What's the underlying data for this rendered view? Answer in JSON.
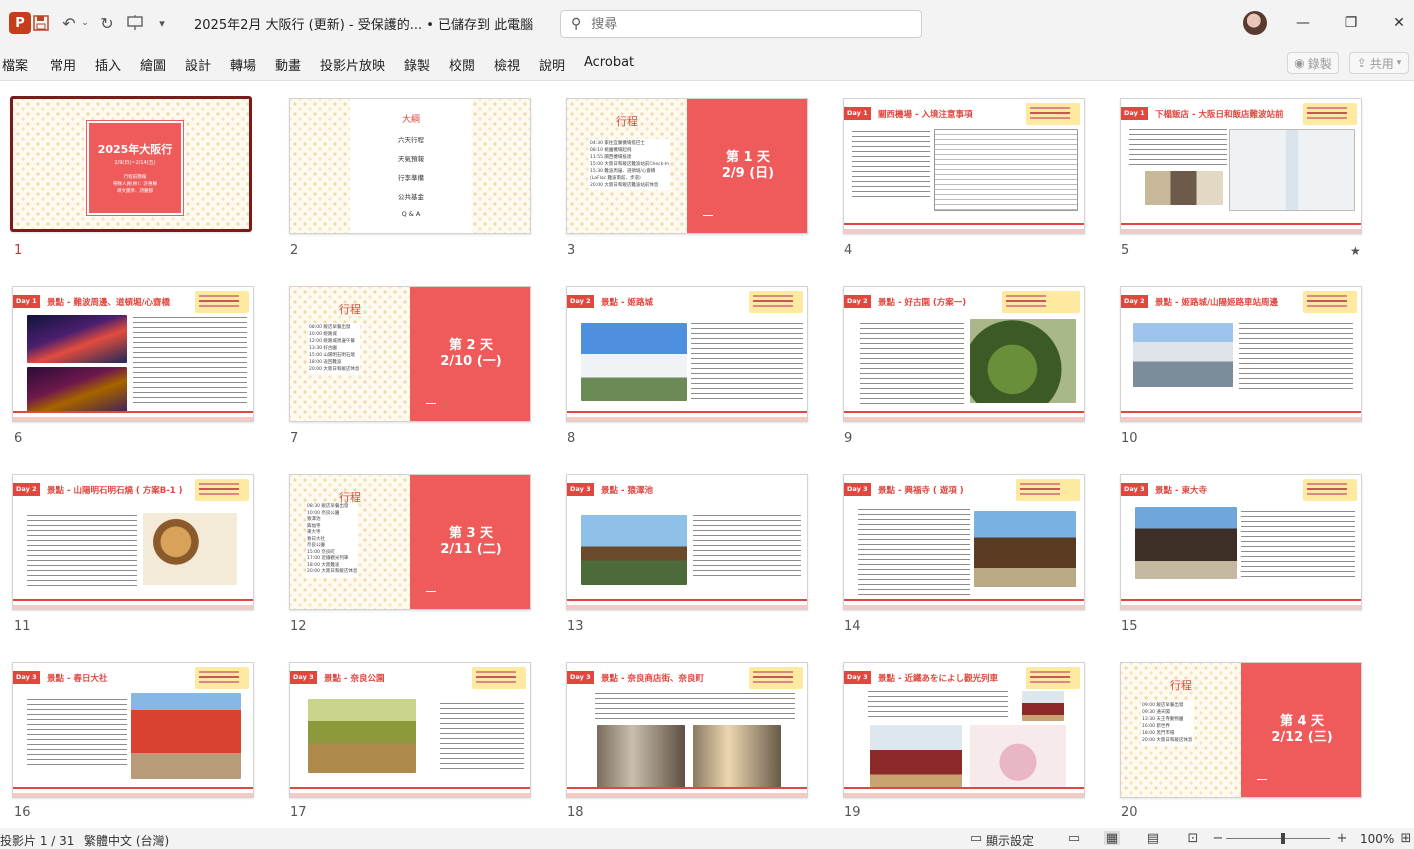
{
  "titlebar": {
    "app_icon": "P",
    "doc_title": "2025年2月 大阪行 (更新)  -  受保護的...  •  已儲存到 此電腦",
    "search_placeholder": "搜尋"
  },
  "menu": [
    "檔案",
    "常用",
    "插入",
    "繪圖",
    "設計",
    "轉場",
    "動畫",
    "投影片放映",
    "錄製",
    "校閱",
    "檢視",
    "說明",
    "Acrobat"
  ],
  "record_label": "錄製",
  "share_label": "共用",
  "cover": {
    "title": "2025年大阪行",
    "date": "2/9(日)~2/14(五)",
    "sub1": "行程前簡報",
    "sub2": "帶隊人員(林)：許惠棟",
    "sub3": "頌文團參、詩麗都"
  },
  "agenda": {
    "title": "大綱",
    "items": [
      "六天行程",
      "天氣預報",
      "行李準備",
      "公共基金",
      "Q & A"
    ]
  },
  "itineraries": [
    {
      "title": "行程",
      "day": "第 1 天",
      "date": "2/9 (日)",
      "lines": [
        "04:30 家往宜蘭機場搭巴士",
        "08:10 桃園機場起飛",
        "11:55 關西機場抵達",
        "15:00 大阪日和飯店難波站前Check-In",
        "15:30 難波周邊、道頓堀/心齋橋",
        "(LaFlac 難波南館、步道)",
        "20:00 大阪日和飯店難波站前休息"
      ]
    },
    {
      "title": "行程",
      "day": "第 2 天",
      "date": "2/10 (一)",
      "lines": [
        "08:00 飯店早餐出發",
        "10:00 姬路城",
        "12:00 姬路城周邊午餐",
        "13:30 好古園",
        "15:00 山陽明石明石燒",
        "18:00 返回難波",
        "20:00 大阪日和飯店休息"
      ]
    },
    {
      "title": "行程",
      "day": "第 3 天",
      "date": "2/11 (二)",
      "lines": [
        "08:30 飯店早餐出發",
        "10:00 奈良公園",
        "猿澤池",
        "興福寺",
        "東大寺",
        "春日大社",
        "奈良公園",
        "15:00 奈良町",
        "17:00 近鐵觀光列車",
        "18:00 大阪難波",
        "20:00 大阪日和飯店休息"
      ]
    },
    {
      "title": "行程",
      "day": "第 4 天",
      "date": "2/12 (三)",
      "lines": [
        "09:00 飯店早餐出發",
        "09:30 通天閣",
        "13:30 天王寺動物園",
        "16:00 新世界",
        "18:00 黑門市場",
        "20:00 大阪日和飯店休息"
      ]
    }
  ],
  "day_slides": [
    {
      "n": "4",
      "day": "Day 1",
      "title": "關西機場 - 入境注意事項"
    },
    {
      "n": "5",
      "day": "Day 1",
      "title": "下榻飯店 - 大阪日和飯店難波站前"
    },
    {
      "n": "6",
      "day": "Day 1",
      "title": "景點 - 難波周邊、道頓堀/心齋橋"
    },
    {
      "n": "8",
      "day": "Day 2",
      "title": "景點 - 姬路城"
    },
    {
      "n": "9",
      "day": "Day 2",
      "title": "景點 - 好古園 (方案一)"
    },
    {
      "n": "10",
      "day": "Day 2",
      "title": "景點 - 姬路城/山陽姬路車站周邊"
    },
    {
      "n": "11",
      "day": "Day 2",
      "title": "景點 - 山陽明石明石燒 ( 方案B-1 )"
    },
    {
      "n": "13",
      "day": "Day 3",
      "title": "景點 - 猿澤池"
    },
    {
      "n": "14",
      "day": "Day 3",
      "title": "景點 - 興福寺 ( 遊項 )"
    },
    {
      "n": "15",
      "day": "Day 3",
      "title": "景點 - 東大寺"
    },
    {
      "n": "16",
      "day": "Day 3",
      "title": "景點 - 春日大社"
    },
    {
      "n": "17",
      "day": "Day 3",
      "title": "景點 - 奈良公園"
    },
    {
      "n": "18",
      "day": "Day 3",
      "title": "景點 - 奈良商店街、奈良町"
    },
    {
      "n": "19",
      "day": "Day 3",
      "title": "景點 - 近鐵あをによし觀光列車"
    }
  ],
  "slide_numbers": [
    "1",
    "2",
    "3",
    "4",
    "5",
    "6",
    "7",
    "8",
    "9",
    "10",
    "11",
    "12",
    "13",
    "14",
    "15",
    "16",
    "17",
    "18",
    "19",
    "20"
  ],
  "star": "★",
  "status": {
    "slide_count": "投影片 1 / 31",
    "language": "繁體中文 (台灣)",
    "display_settings": "顯示設定",
    "zoom": "100%"
  }
}
